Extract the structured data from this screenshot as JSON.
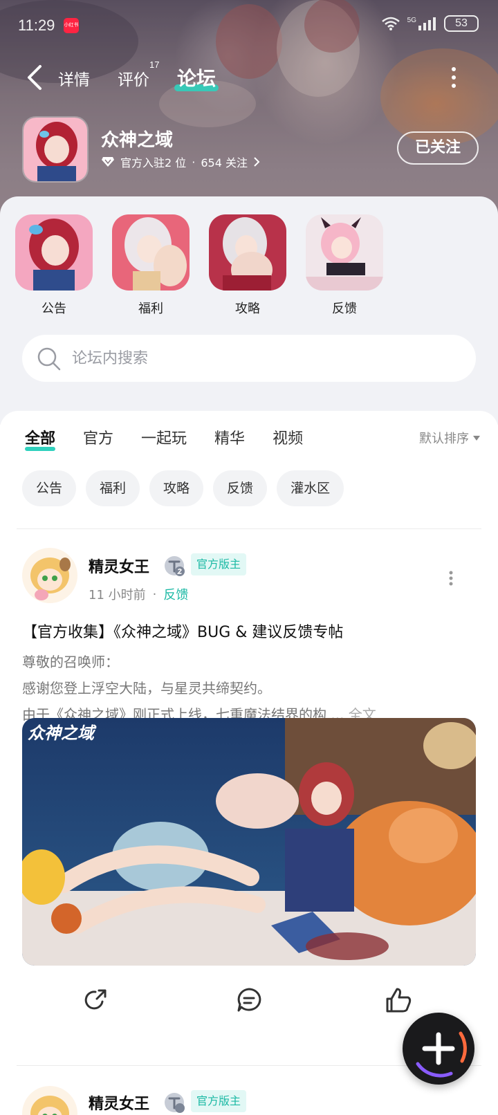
{
  "status_bar": {
    "time": "11:29",
    "app_badge": "小红书",
    "network": "5G",
    "battery": "53"
  },
  "nav": {
    "tabs": [
      {
        "label": "详情"
      },
      {
        "label": "评价",
        "count": "17"
      },
      {
        "label": "论坛",
        "active": true
      }
    ]
  },
  "game": {
    "name": "众神之域",
    "official_count": "官方入驻2 位",
    "separator": "·",
    "followers": "654 关注",
    "follow_label": "已关注"
  },
  "quick_entries": [
    {
      "label": "公告"
    },
    {
      "label": "福利"
    },
    {
      "label": "攻略"
    },
    {
      "label": "反馈"
    }
  ],
  "search": {
    "placeholder": "论坛内搜索"
  },
  "category_tabs": [
    {
      "label": "全部",
      "active": true
    },
    {
      "label": "官方"
    },
    {
      "label": "一起玩"
    },
    {
      "label": "精华"
    },
    {
      "label": "视频"
    }
  ],
  "sort": {
    "label": "默认排序"
  },
  "chips": [
    "公告",
    "福利",
    "攻略",
    "反馈",
    "灌水区"
  ],
  "post": {
    "author": "精灵女王",
    "badge": "官方版主",
    "time": "11 小时前",
    "separator": "·",
    "category": "反馈",
    "title": "【官方收集】《众神之域》BUG & 建议反馈专帖",
    "body_lines": [
      "尊敬的召唤师：",
      "感谢您登上浮空大陆，与星灵共缔契约。",
      "由于《众神之域》刚正式上线，七重魔法结界的构"
    ],
    "ellipsis": " ... ",
    "fulltext_label": "全文",
    "image_caption": "众神之域"
  },
  "post2": {
    "author": "精灵女王",
    "badge": "官方版主"
  },
  "colors": {
    "accent": "#2fd0bd",
    "accent_text": "#1bb9a4",
    "panel_bg": "#f1f2f6"
  },
  "icons": [
    "back-icon",
    "more-vertical-icon",
    "diamond-icon",
    "chevron-right-icon",
    "search-icon",
    "share-icon",
    "comment-icon",
    "like-icon",
    "plus-icon",
    "wifi-icon",
    "signal-icon"
  ]
}
